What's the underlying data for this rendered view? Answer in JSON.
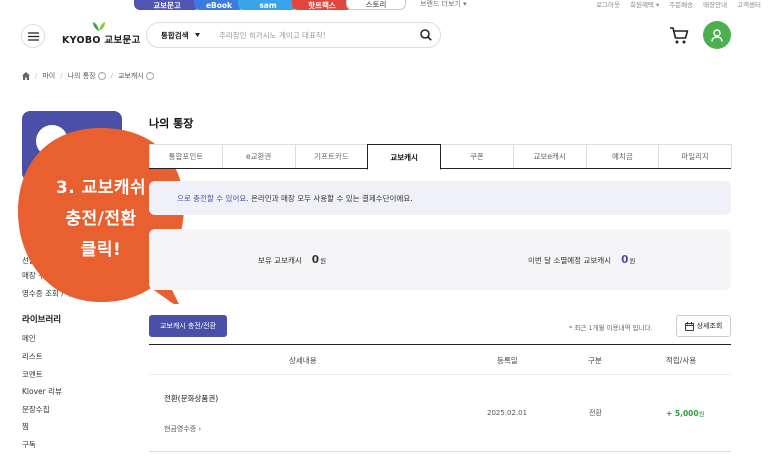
{
  "top_bar": {
    "service_tabs": [
      "교보문고",
      "eBook",
      "sam",
      "핫트랙스",
      "스토리"
    ],
    "more_label": "브랜드 더보기 ▾",
    "util_links": [
      "로그아웃",
      "회원혜택 ▾",
      "주문배송",
      "매장안내",
      "고객센터"
    ]
  },
  "header": {
    "logo_text": "KYOBO 교보문고",
    "search_category": "통합검색",
    "search_placeholder": "추리장인 히가시노 게이고 대표작!"
  },
  "breadcrumb": [
    "마이",
    "나의 통장",
    "교보캐시"
  ],
  "sidebar": {
    "links_top": [
      "선물함",
      "매장 구매 내역",
      "영수증 조회 / 후 적립"
    ],
    "heading": "라이브러리",
    "library_links": [
      "메인",
      "리스트",
      "코멘트",
      "Klover 리뷰",
      "문장수집",
      "찜",
      "구독"
    ]
  },
  "bubble_lines": [
    "3. 교보캐쉬",
    "충전/전환",
    "클릭!"
  ],
  "main": {
    "title": "나의 통장",
    "tabs": [
      "통합포인트",
      "e교환권",
      "기프트카드",
      "교보캐시",
      "쿠폰",
      "교보e캐시",
      "예치금",
      "마일리지"
    ],
    "active_tab": 3,
    "info_highlight": "으로 충전할 수 있어요.",
    "info_rest": " 온라인과 매장 모두 사용할 수 있는 결제수단이에요.",
    "balance": {
      "owned_label": "보유 교보캐시",
      "owned_value": "0",
      "expire_label": "이번 달 소멸예정 교보캐시",
      "expire_value": "0",
      "unit": "원"
    },
    "charge_button": "교보캐시 충전/전환",
    "recent_note": "* 최근 1개월 이용내역 입니다.",
    "detail_button": "상세조회",
    "table": {
      "headers": [
        "상세내용",
        "등록일",
        "구분",
        "적립/사용"
      ],
      "rows": [
        {
          "title": "전환(문화상품권)",
          "receipt": "현금영수증 ›",
          "date": "2025.02.01",
          "type": "전환",
          "amount": "+ 5,000",
          "unit": "원"
        }
      ]
    }
  },
  "colors": {
    "brand_purple": "#4a4fa8",
    "bubble_orange": "#e85f30",
    "green_amount": "#2e9a3c",
    "user_green": "#4cb050"
  }
}
